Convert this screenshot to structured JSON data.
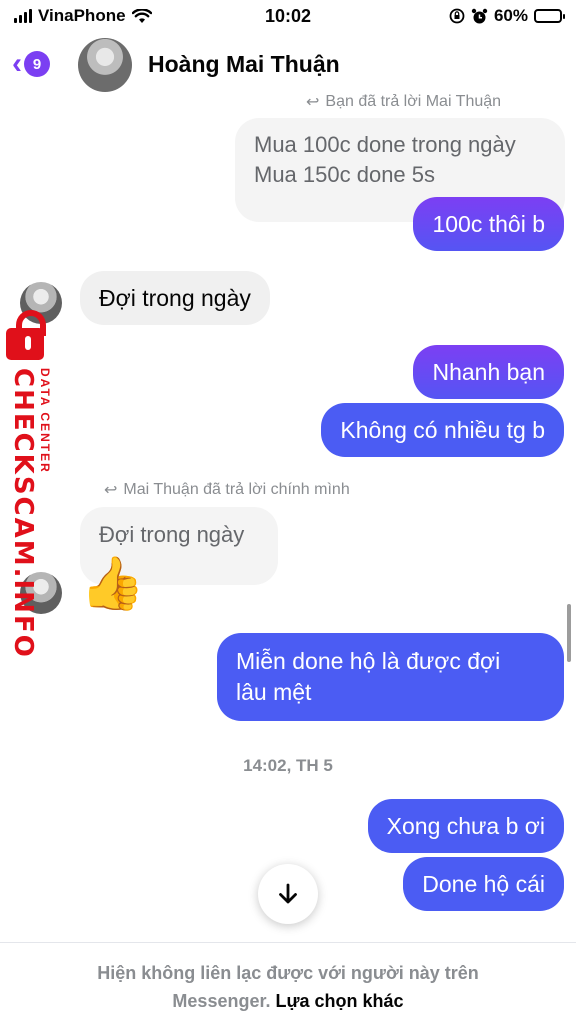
{
  "status_bar": {
    "carrier": "VinaPhone",
    "time": "10:02",
    "battery_percent": "60%",
    "battery_level": 0.6
  },
  "header": {
    "unread_count": "9",
    "contact_name": "Hoàng Mai Thuận"
  },
  "messages": {
    "reply_note_top": "Bạn đã trả lời Mai Thuận",
    "quoted_top_line1": "Mua 100c done trong ngày",
    "quoted_top_line2": "Mua 150c done 5s",
    "m1": "100c thôi b",
    "m2": "Đợi trong ngày",
    "m3": "Nhanh bạn",
    "m4": "Không có nhiều tg b",
    "reply_note_mid": "Mai Thuận đã trả lời chính mình",
    "quoted_mid": "Đợi trong ngày",
    "m5_line1": "Miễn done hộ là được đợi",
    "m5_line2": "lâu mệt",
    "timestamp": "14:02, TH 5",
    "m6": "Xong chưa b ơi",
    "m7": "Done hộ cái"
  },
  "watermark": {
    "main": "CHECKSCAM.INFO",
    "sub": "DATA CENTER"
  },
  "footer": {
    "notice_line1": "Hiện không liên lạc được với người này trên",
    "notice_line2": "Messenger.",
    "action_label": "Lựa chọn khác"
  },
  "colors": {
    "accent": "#7b3ff2",
    "outgoing_blue": "#4b5cf3",
    "watermark_red": "#e0101a"
  },
  "icons": {
    "back": "chevron-left-icon",
    "scroll_down": "arrow-down-icon",
    "reaction": "thumbs-up-icon",
    "reply": "reply-arrow-icon"
  }
}
